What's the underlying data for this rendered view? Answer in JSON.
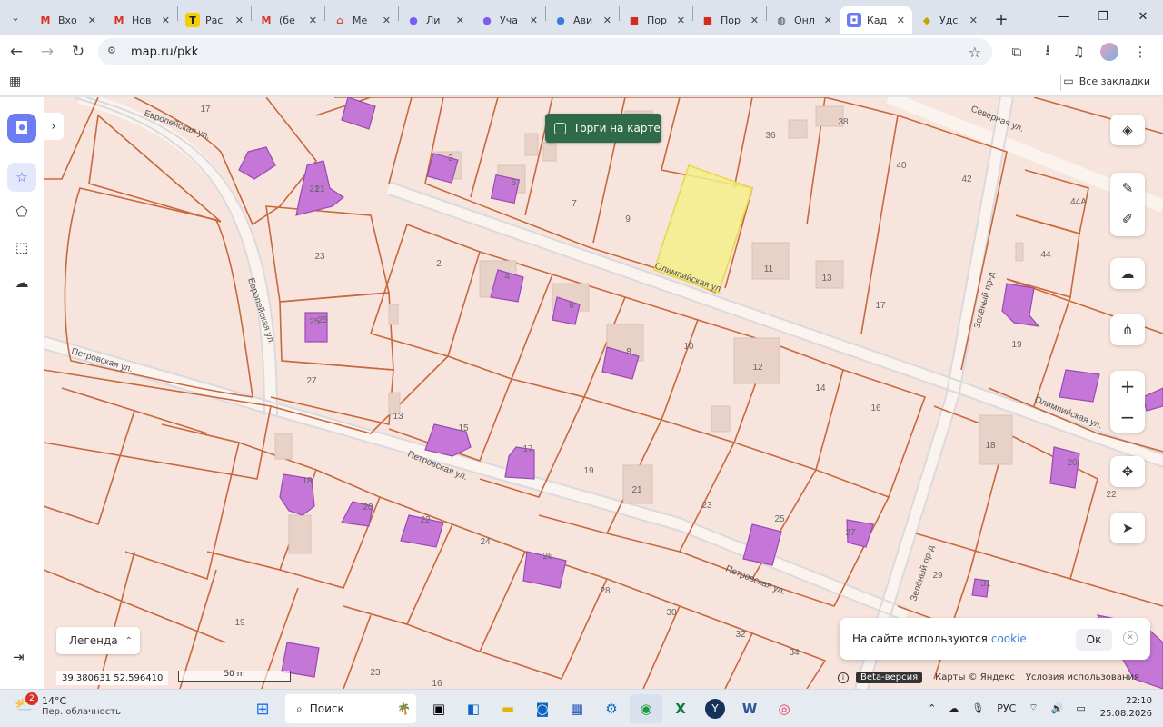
{
  "browser": {
    "tabs": [
      {
        "icon": "M",
        "icon_color": "#d93025",
        "icon_bg": "transparent",
        "title": "Вхо"
      },
      {
        "icon": "M",
        "icon_color": "#d93025",
        "icon_bg": "transparent",
        "title": "Нов"
      },
      {
        "icon": "T",
        "icon_color": "#222",
        "icon_bg": "#f5d000",
        "title": "Рас"
      },
      {
        "icon": "M",
        "icon_color": "#d93025",
        "icon_bg": "transparent",
        "title": "(бе"
      },
      {
        "icon": "⌂",
        "icon_color": "#c9553a",
        "icon_bg": "transparent",
        "title": "Ме"
      },
      {
        "icon": "●",
        "icon_color": "#7a5cf0",
        "icon_bg": "transparent",
        "title": "Ли"
      },
      {
        "icon": "●",
        "icon_color": "#7a5cf0",
        "icon_bg": "transparent",
        "title": "Уча"
      },
      {
        "icon": "●",
        "icon_color": "#3c7dd9",
        "icon_bg": "transparent",
        "title": "Ави"
      },
      {
        "icon": "■",
        "icon_color": "#d52b1e",
        "icon_bg": "transparent",
        "title": "Пор"
      },
      {
        "icon": "■",
        "icon_color": "#d52b1e",
        "icon_bg": "transparent",
        "title": "Пор"
      },
      {
        "icon": "◍",
        "icon_color": "#555",
        "icon_bg": "transparent",
        "title": "Онл"
      },
      {
        "icon": "◘",
        "icon_color": "#fff",
        "icon_bg": "#6b7cf5",
        "title": "Кад",
        "active": true
      },
      {
        "icon": "◆",
        "icon_color": "#c7a200",
        "icon_bg": "transparent",
        "title": "Удс"
      }
    ],
    "url": "map.ru/pkk",
    "bookmarks_all": "Все закладки"
  },
  "map_ui": {
    "torgi_label": "Торги на карте",
    "legend_label": "Легенда",
    "coords": "39.380631  52.596410",
    "scale": "50 m",
    "cookie_text": "На сайте используются",
    "cookie_link": "cookie",
    "cookie_ok": "Ок",
    "beta": "Beta-версия",
    "maps_credit": "Карты © Яндекс",
    "terms": "Условия использования"
  },
  "map": {
    "streets": [
      "Олимпийская ул.",
      "Олимпийская ул.",
      "Петровская ул.",
      "Петровская ул.",
      "Петровская ул.",
      "Европейская ул.",
      "Европейская ул.",
      "Северная ул.",
      "Зелёный пр-д",
      "Зелёный пр-д"
    ],
    "parcel_numbers": [
      "17",
      "3",
      "5",
      "7",
      "9",
      "36",
      "38",
      "40",
      "42",
      "44А",
      "44",
      "21",
      "23",
      "2",
      "4",
      "6",
      "11",
      "13",
      "17",
      "25",
      "27",
      "8",
      "10",
      "12",
      "14",
      "16",
      "19",
      "13",
      "15",
      "17",
      "19",
      "21",
      "23",
      "25",
      "27",
      "18",
      "20",
      "22",
      "24",
      "26",
      "28",
      "30",
      "32",
      "34",
      "19",
      "23",
      "29",
      "31",
      "18",
      "20",
      "22",
      "21",
      "25",
      "16",
      "19"
    ]
  },
  "taskbar": {
    "temp": "14°C",
    "weather_desc": "Пер. облачность",
    "notif_count": "2",
    "search_label": "Поиск",
    "lang": "РУС",
    "time": "22:10",
    "date": "25.08.2026"
  },
  "colors": {
    "parcel_line": "#c7683e",
    "building_fill": "#c477d6",
    "selected_parcel": "#f6f08a",
    "map_bg": "#f7e5dd",
    "torgi_bg": "#2f6b49"
  }
}
